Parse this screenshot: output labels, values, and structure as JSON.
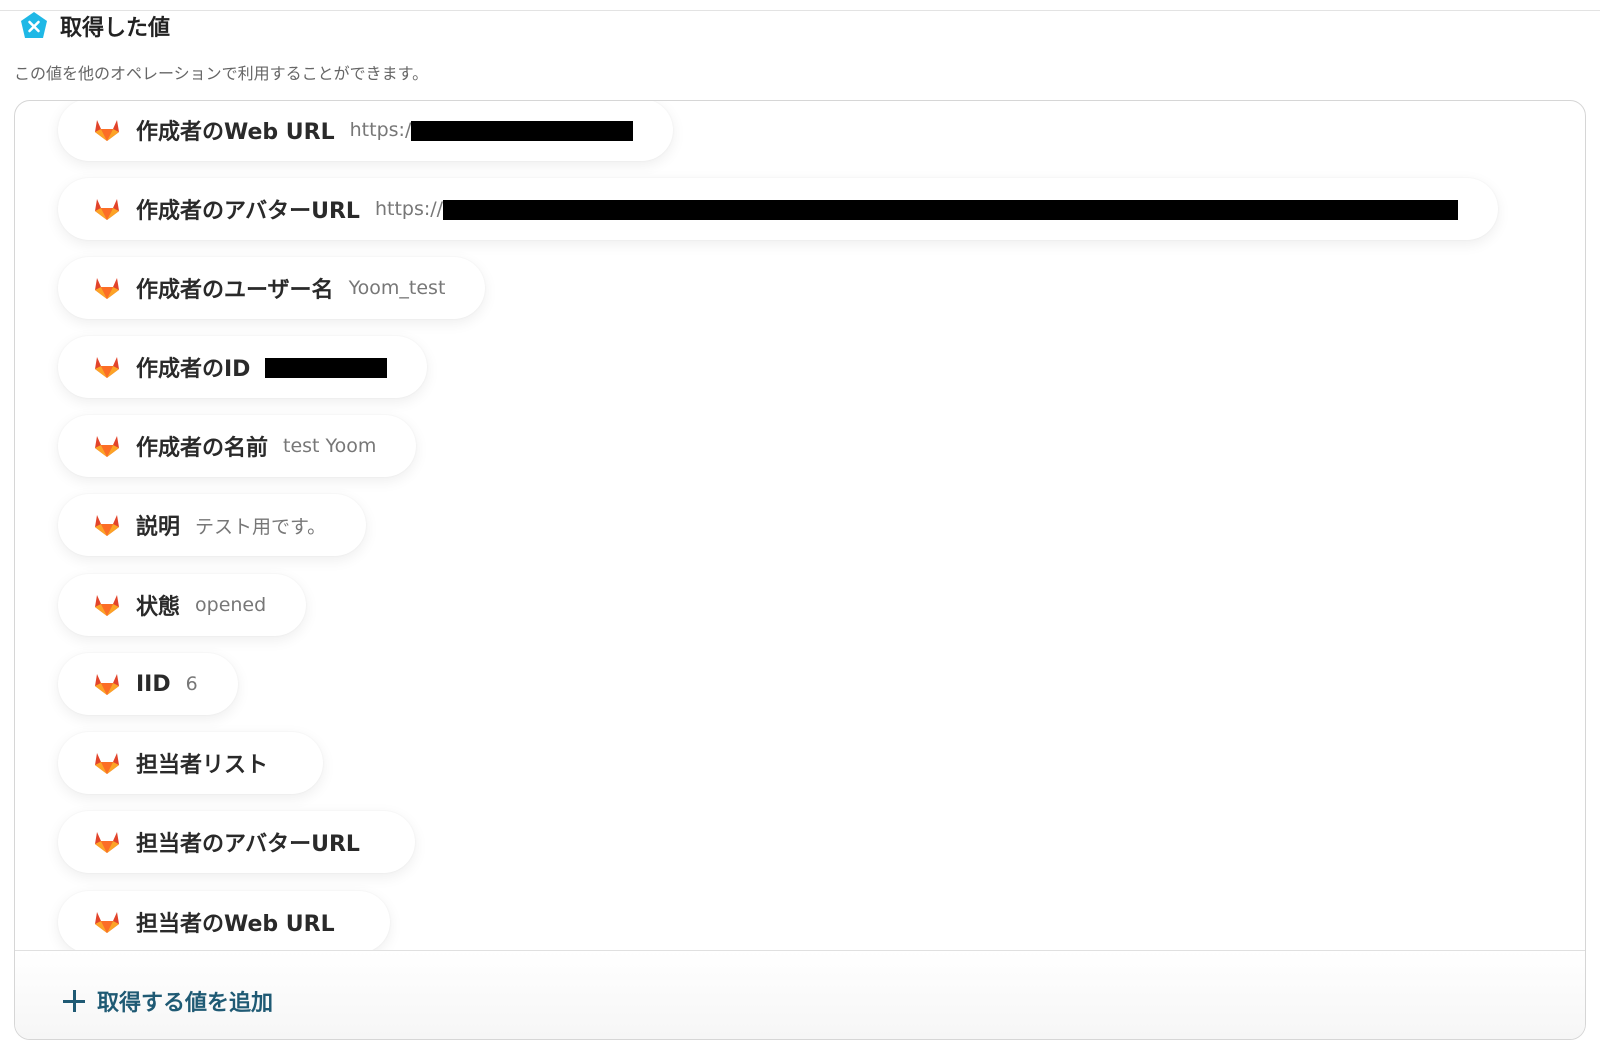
{
  "header": {
    "icon": "yoom-x-icon",
    "title": "取得した値",
    "subtitle": "この値を他のオペレーションで利用することができます。"
  },
  "colors": {
    "brand": "#1fb8e6",
    "gitlab_orange": "#e2432a",
    "gitlab_light": "#fc6d26",
    "gitlab_yellow": "#fca326",
    "link": "#1f5a74"
  },
  "items": [
    {
      "icon": "gitlab-icon",
      "label": "作成者のWeb URL",
      "value": "https:/",
      "redacted": true
    },
    {
      "icon": "gitlab-icon",
      "label": "作成者のアバターURL",
      "value": "https://",
      "redacted": true
    },
    {
      "icon": "gitlab-icon",
      "label": "作成者のユーザー名",
      "value": "Yoom_test",
      "redacted": false
    },
    {
      "icon": "gitlab-icon",
      "label": "作成者のID",
      "value": "",
      "redacted": true
    },
    {
      "icon": "gitlab-icon",
      "label": "作成者の名前",
      "value": "test Yoom",
      "redacted": false
    },
    {
      "icon": "gitlab-icon",
      "label": "説明",
      "value": "テスト用です。",
      "redacted": false
    },
    {
      "icon": "gitlab-icon",
      "label": "状態",
      "value": "opened",
      "redacted": false
    },
    {
      "icon": "gitlab-icon",
      "label": "IID",
      "value": "6",
      "redacted": false
    },
    {
      "icon": "gitlab-icon",
      "label": "担当者リスト",
      "value": "",
      "redacted": false
    },
    {
      "icon": "gitlab-icon",
      "label": "担当者のアバターURL",
      "value": "",
      "redacted": false
    },
    {
      "icon": "gitlab-icon",
      "label": "担当者のWeb URL",
      "value": "",
      "redacted": false
    }
  ],
  "footer": {
    "add_icon": "plus-icon",
    "add_label": "取得する値を追加"
  }
}
